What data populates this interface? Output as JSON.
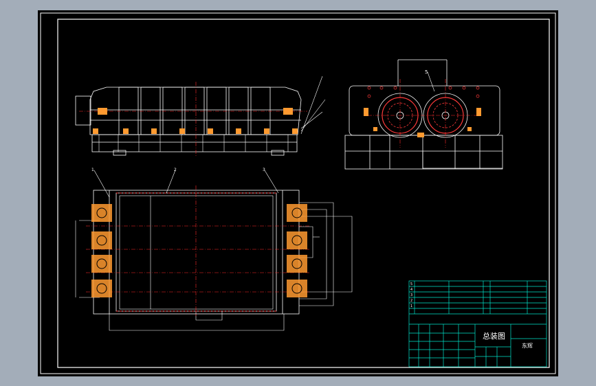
{
  "colors": {
    "background": "#000000",
    "frame": "#ffffff",
    "outline": "#ffffff",
    "centerline": "#ff2a2a",
    "hatch": "#ff3a3a",
    "parts": "#ff9a30",
    "titleblock": "#00e5cc",
    "text": "#ffffff",
    "list_text": "#00ff66"
  },
  "front_view": {
    "callouts": [
      "",
      "",
      ""
    ],
    "dimensions": [
      "",
      "",
      ""
    ]
  },
  "side_view": {
    "callout": "5",
    "dimensions": [
      "",
      ""
    ]
  },
  "plan_view": {
    "callouts": [
      "1",
      "2",
      "3"
    ],
    "dimensions": [
      "",
      "",
      "",
      ""
    ]
  },
  "title_block": {
    "parts_list": [
      {
        "no": "5",
        "code": "",
        "name": "",
        "qty": "",
        "material": ""
      },
      {
        "no": "4",
        "code": "",
        "name": "",
        "qty": "",
        "material": ""
      },
      {
        "no": "3",
        "code": "",
        "name": "",
        "qty": "",
        "material": ""
      },
      {
        "no": "2",
        "code": "",
        "name": "",
        "qty": "",
        "material": ""
      },
      {
        "no": "1",
        "code": "",
        "name": "",
        "qty": "",
        "material": ""
      }
    ],
    "drawing_name": "总装图",
    "company": "东辉"
  }
}
